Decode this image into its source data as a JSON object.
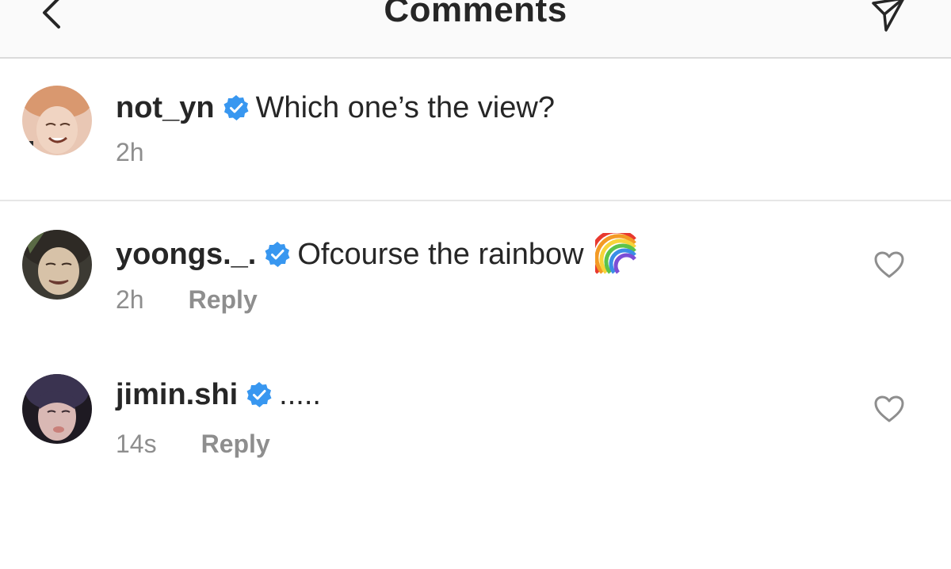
{
  "header": {
    "title": "Comments"
  },
  "caption": {
    "username": "not_yn",
    "text": "Which one’s the view?",
    "time": "2h"
  },
  "comments": [
    {
      "username": "yoongs._.",
      "text": "Ofcourse the rainbow",
      "emoji": "rainbow-emoji",
      "time": "2h",
      "reply_label": "Reply"
    },
    {
      "username": "jimin.shi",
      "text": ".....",
      "time": "14s",
      "reply_label": "Reply"
    }
  ],
  "colors": {
    "verified_badge": "#3897f0",
    "muted_text": "#8e8e8e",
    "header_bg": "#fafafa"
  }
}
